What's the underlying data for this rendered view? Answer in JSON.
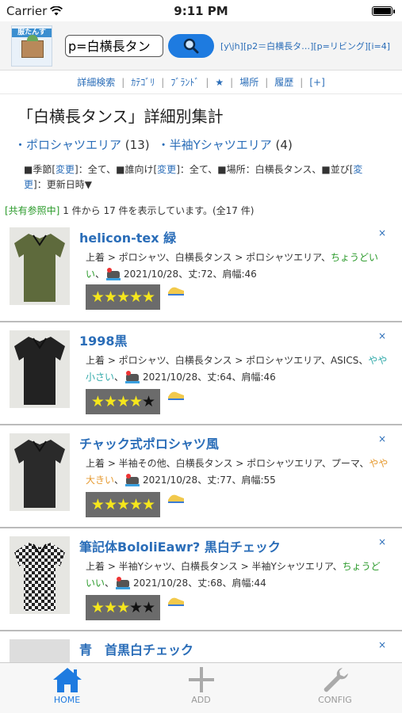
{
  "status": {
    "carrier": "Carrier",
    "time": "9:11 PM"
  },
  "header": {
    "logo_text": "服たんす",
    "search_value": "p=白横長タンス",
    "params": "[y\\jh][p2＝白横長タ…][p=リビング][i=4]"
  },
  "nav": [
    "詳細検索",
    "ｶﾃｺﾞﾘ",
    "ﾌﾞﾗﾝﾄﾞ",
    "★",
    "場所",
    "履歴",
    "[+]"
  ],
  "page_title": "「白横長タンス」詳細別集計",
  "categories": [
    {
      "label": "・ポロシャツエリア",
      "count": "(13)"
    },
    {
      "label": "・半袖Yシャツエリア",
      "count": "(4)"
    }
  ],
  "filters": {
    "season_prefix": "■季節[",
    "change": "変更",
    "season_suffix": "]：全て、",
    "target_prefix": "■誰向け[",
    "target_suffix": "]：全て、",
    "place": "■場所：白横長タンス、",
    "sort_prefix": "■並び[",
    "change_a": "変",
    "change_b": "更",
    "sort_suffix": "]：更新日時▼"
  },
  "results": {
    "shared": "[共有参照中]",
    "text": " 1 件から 17 件を表示しています。(全17 件)"
  },
  "items": [
    {
      "title": "helicon-tex 緑",
      "close": "×",
      "desc_main": "上着 > ポロシャツ、白横長タンス > ポロシャツエリア、",
      "fit": "ちょうどいい",
      "fit_color": "green",
      "after": "、",
      "date_info": "2021/10/28、丈:72、肩幅:46",
      "stars_on": "★★★★★",
      "stars_off": "",
      "shirt_color": "#5e6a3c"
    },
    {
      "title": "1998黒",
      "close": "×",
      "desc_main": "上着 > ポロシャツ、白横長タンス > ポロシャツエリア、ASICS、",
      "fit": "やや小さい",
      "fit_color": "teal",
      "after": "、",
      "date_info": "2021/10/28、丈:64、肩幅:46",
      "stars_on": "★★★★",
      "stars_off": "★",
      "shirt_color": "#222222"
    },
    {
      "title": "チャック式ポロシャツ風",
      "close": "×",
      "desc_main": "上着 > 半袖その他、白横長タンス > ポロシャツエリア、プーマ、",
      "fit": "やや大きい",
      "fit_color": "orange",
      "after": "、",
      "date_info": "2021/10/28、丈:77、肩幅:55",
      "stars_on": "★★★★★",
      "stars_off": "",
      "shirt_color": "#2a2a2a"
    },
    {
      "title": "筆記体BololiEawr? 黒白チェック",
      "close": "×",
      "desc_main": "上着 > 半袖Yシャツ、白横長タンス > 半袖Yシャツエリア、",
      "fit": "ちょうどいい",
      "fit_color": "green",
      "after": "、",
      "date_info": "2021/10/28、丈:68、肩幅:44",
      "stars_on": "★★★",
      "stars_off": "★★",
      "shirt_color": "#444444"
    }
  ],
  "partial_item": {
    "title": "青　首黒白チェック",
    "close": "×"
  },
  "tabs": [
    {
      "label": "HOME",
      "icon": "home-icon"
    },
    {
      "label": "ADD",
      "icon": "plus-icon"
    },
    {
      "label": "CONFIG",
      "icon": "wrench-icon"
    }
  ]
}
